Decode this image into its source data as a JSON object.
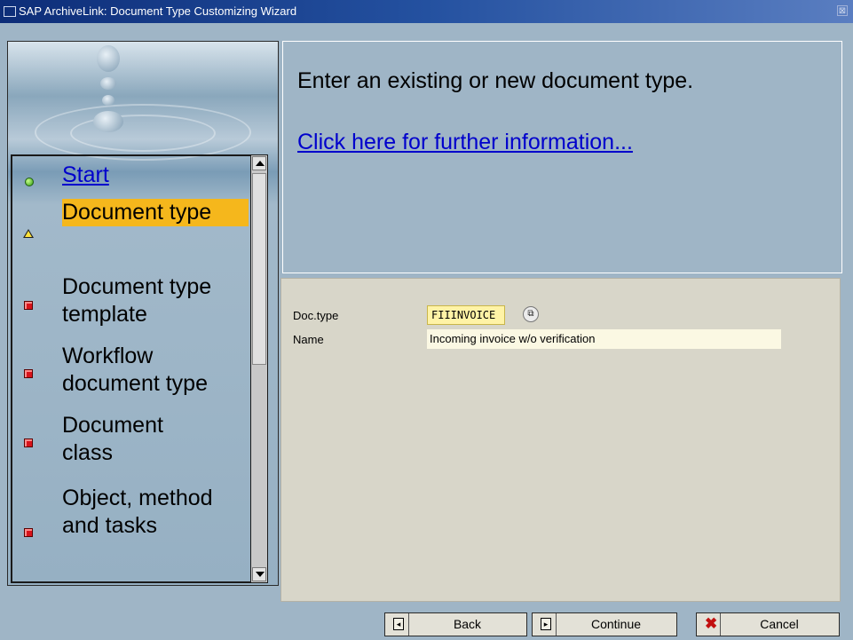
{
  "window": {
    "title": "SAP ArchiveLink: Document Type Customizing Wizard",
    "close_glyph": "⊠"
  },
  "nav": {
    "items": [
      {
        "label": "Start",
        "status": "completed",
        "marker_color": "#3aa01e"
      },
      {
        "label": "Document type",
        "status": "current",
        "marker_color": "#ffe23a"
      },
      {
        "label": "Document type template",
        "status": "pending",
        "marker_color": "#d8131b"
      },
      {
        "label": "Workflow document type",
        "status": "pending",
        "marker_color": "#d8131b"
      },
      {
        "label": "Document class",
        "status": "pending",
        "marker_color": "#d8131b"
      },
      {
        "label": "Object, method and tasks",
        "status": "pending",
        "marker_color": "#d8131b"
      }
    ],
    "active_color": "#f5b71c"
  },
  "info": {
    "heading": "Enter an existing or new document type.",
    "link": "Click here for further information..."
  },
  "form": {
    "doctype_label": "Doc.type",
    "doctype_value": "FIIINVOICE",
    "name_label": "Name",
    "name_value": "Incoming invoice w/o verification"
  },
  "buttons": {
    "back": "Back",
    "continue": "Continue",
    "cancel": "Cancel"
  }
}
